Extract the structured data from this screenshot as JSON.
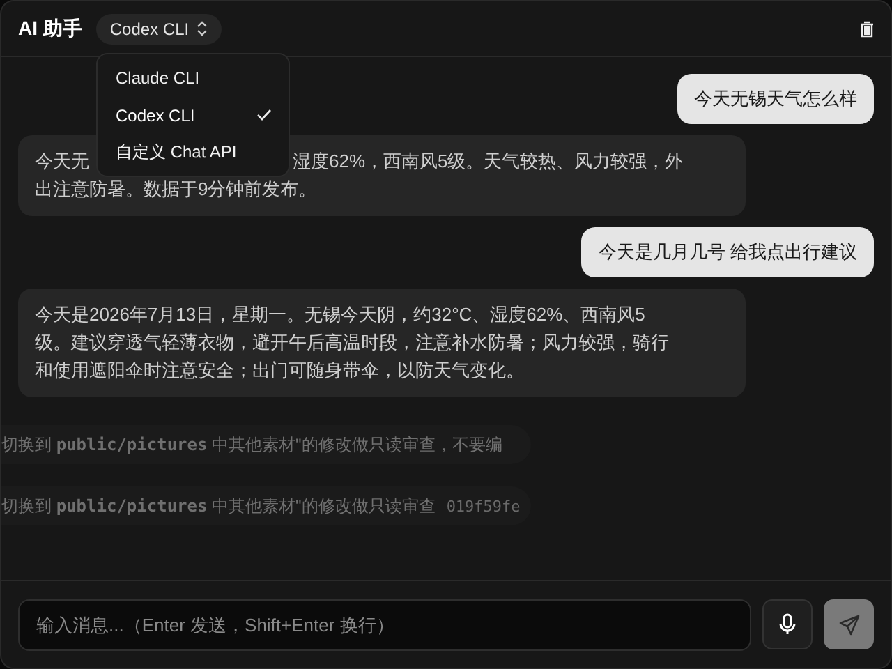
{
  "header": {
    "title": "AI 助手",
    "model_select": "Codex CLI",
    "menu": {
      "open": true,
      "items": [
        {
          "label": "Claude CLI",
          "selected": false
        },
        {
          "label": "Codex CLI",
          "selected": true
        },
        {
          "label": "自定义 Chat API",
          "selected": false
        }
      ]
    }
  },
  "messages": [
    {
      "kind": "user",
      "text": "今天无锡天气怎么样"
    },
    {
      "kind": "assistant",
      "text": "今天无",
      "text_after_menu": "湿度62%，西南风5级。天气较热、风力较强，外",
      "text_next_line": "出注意防暑。数据于9分钟前发布。"
    },
    {
      "kind": "user",
      "text": "今天是几月几号 给我点出行建议"
    },
    {
      "kind": "assistant",
      "lines": [
        "今天是2026年7月13日，星期一。无锡今天阴，约32°C、湿度62%、西南风5",
        "级。建议穿透气轻薄衣物，避开午后高温时段，注意补水防暑；风力较强，骑行",
        "和使用遮阳伞时注意安全；出门可随身带伞，以防天气变化。"
      ]
    }
  ],
  "faded_rows": [
    {
      "text": "切换到 ",
      "code": "public/pictures",
      "rest": " 中其他素材\"的修改做只读审查，不要编"
    },
    {
      "text": "切换到 ",
      "code": "public/pictures",
      "rest": " 中其他素材\"的修改做只读审查",
      "tag": "019f59fe"
    }
  ],
  "composer": {
    "placeholder": "输入消息...（Enter 发送，Shift+Enter 换行）"
  }
}
